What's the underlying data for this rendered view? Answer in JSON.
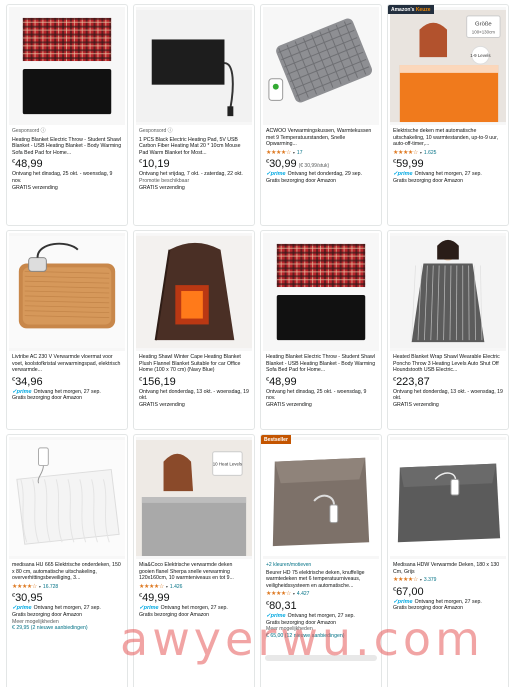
{
  "products": [
    {
      "badge": "",
      "sponsored": "Gesponsord",
      "title": "Heating Blanket Electric Throw - Student Shawl Blanket - USB Heating Blanket - Body Warming Sofa Bed Pad for Home...",
      "rating": "",
      "rating_count": "",
      "currency": "€",
      "price": "48,99",
      "unit_price": "",
      "prime": false,
      "delivery": "Ontvang het dinsdag, 25 okt. - woensdag, 9 nov.",
      "extra1": "GRATIS verzending",
      "extra2": "",
      "more": ""
    },
    {
      "badge": "",
      "sponsored": "Gesponsord",
      "title": "1 PCS Black Electric Heating Pad, 5V USB Carbon Fiber Heating Mat 20 * 10cm Mouse Pad Warm Blanket for Most...",
      "rating": "",
      "rating_count": "",
      "currency": "€",
      "price": "10,19",
      "unit_price": "",
      "prime": false,
      "delivery": "Ontvang het vrijdag, 7 okt. - zaterdag, 22 okt.",
      "extra1": "Promotie beschikbaar",
      "extra2": "GRATIS verzending",
      "more": ""
    },
    {
      "badge": "",
      "sponsored": "",
      "title": "ACWOO Verwarmingskussen, Warmtekussen met 9 Temperatuurstanden, Snelle Opwarming...",
      "rating": "★★★★☆",
      "rating_count": "17",
      "currency": "€",
      "price": "30,99",
      "unit_price": "(€ 30,99/stuk)",
      "prime": true,
      "delivery": "Ontvang het donderdag, 29 sep.",
      "extra1": "Gratis bezorging door Amazon",
      "extra2": "",
      "more": ""
    },
    {
      "badge": "Amazon's Keuze",
      "sponsored": "",
      "title": "Elektrische deken met automatische uitschakeling, 10 warmtestanden, up-to-9 uur, auto-off-timer,...",
      "rating": "★★★★☆",
      "rating_count": "1.625",
      "currency": "€",
      "price": "59,99",
      "unit_price": "",
      "prime": true,
      "delivery": "Ontvang het morgen, 27 sep.",
      "extra1": "Gratis bezorging door Amazon",
      "extra2": "",
      "more": ""
    },
    {
      "badge": "",
      "sponsored": "",
      "title": "Livtribe AC 230 V Verwarmde vloermat voor voet, koolstofkristal verwarmingspad, elektrisch verwarmde...",
      "rating": "",
      "rating_count": "",
      "currency": "€",
      "price": "34,96",
      "unit_price": "",
      "prime": true,
      "delivery": "Ontvang het morgen, 27 sep.",
      "extra1": "Gratis bezorging door Amazon",
      "extra2": "",
      "more": ""
    },
    {
      "badge": "",
      "sponsored": "",
      "title": "Heating Shawl Winter Cape Heating Blanket Plush Flannel Blanket Suitable for car Office Home (100 x 70 cm) (Navy Blue)",
      "rating": "",
      "rating_count": "",
      "currency": "€",
      "price": "156,19",
      "unit_price": "",
      "prime": false,
      "delivery": "Ontvang het donderdag, 13 okt. - woensdag, 19 okt.",
      "extra1": "GRATIS verzending",
      "extra2": "",
      "more": ""
    },
    {
      "badge": "",
      "sponsored": "",
      "title": "Heating Blanket Electric Throw - Student Shawl Blanket - USB Heating Blanket - Body Warming Sofa Bed Pad for Home...",
      "rating": "",
      "rating_count": "",
      "currency": "€",
      "price": "48,99",
      "unit_price": "",
      "prime": false,
      "delivery": "Ontvang het dinsdag, 25 okt. - woensdag, 9 nov.",
      "extra1": "GRATIS verzending",
      "extra2": "",
      "more": ""
    },
    {
      "badge": "",
      "sponsored": "",
      "title": "Heated Blanket Wrap Shawl Wearable Electric Poncho Throw 3 Heating Levels Auto Shut Off Houndstooth USB Electric...",
      "rating": "",
      "rating_count": "",
      "currency": "€",
      "price": "223,87",
      "unit_price": "",
      "prime": false,
      "delivery": "Ontvang het donderdag, 13 okt. - woensdag, 19 okt.",
      "extra1": "GRATIS verzending",
      "extra2": "",
      "more": ""
    },
    {
      "badge": "",
      "sponsored": "",
      "title": "medisana HU 665 Elektrische onderdeken, 150 x 80 cm, automatische uitschakeling, oververhittingsbeveiliging, 3...",
      "rating": "★★★★☆",
      "rating_count": "16.728",
      "currency": "€",
      "price": "30,95",
      "unit_price": "",
      "prime": true,
      "delivery": "Ontvang het morgen, 27 sep.",
      "extra1": "Gratis bezorging door Amazon",
      "extra2": "Meer mogelijkheden",
      "more": "€ 29,95 (2 nieuwe aanbiedingen)"
    },
    {
      "badge": "",
      "sponsored": "",
      "title": "Mia&Coco Elektrische verwarmde deken gooien flanel Sherpa snelle verwarming 120x160cm, 10 warmteniveaus en tot 9...",
      "rating": "★★★★☆",
      "rating_count": "1.426",
      "currency": "€",
      "price": "49,99",
      "unit_price": "",
      "prime": true,
      "delivery": "Ontvang het morgen, 27 sep.",
      "extra1": "Gratis bezorging door Amazon",
      "extra2": "",
      "more": ""
    },
    {
      "badge": "Bestseller",
      "sponsored": "",
      "title": "Beurer HD 75 elektrische deken, knuffelige warmtedeken met 6 temperatuurniveaus, veiligheidssysteem en automatische...",
      "rating": "★★★★☆",
      "rating_count": "4.427",
      "currency": "€",
      "price": "80,31",
      "unit_price": "",
      "prime": true,
      "delivery": "Ontvang het morgen, 27 sep.",
      "extra1": "Gratis bezorging door Amazon",
      "extra2": "Meer mogelijkheden",
      "more": "€ 65,00 (12 nieuwe aanbiedingen)",
      "colors_link": "+2 kleuren/motieven"
    },
    {
      "badge": "",
      "sponsored": "",
      "title": "Medisana HDW Verwarmde Deken, 180 x 130 Cm, Grijs",
      "rating": "★★★★☆",
      "rating_count": "3.379",
      "currency": "€",
      "price": "67,00",
      "unit_price": "",
      "prime": true,
      "delivery": "Ontvang het morgen, 27 sep.",
      "extra1": "Gratis bezorging door Amazon",
      "extra2": "",
      "more": ""
    }
  ],
  "prime_label": "✓prime",
  "badge_choice_prefix": "Amazon's",
  "badge_choice_suffix": "Keuze",
  "watermark": "awyerwu.com",
  "image_labels": {
    "p4_box": "Größe 100×130cm",
    "p4_box2": "1-9 Levels",
    "p10_box": "10 Heat Levels"
  }
}
